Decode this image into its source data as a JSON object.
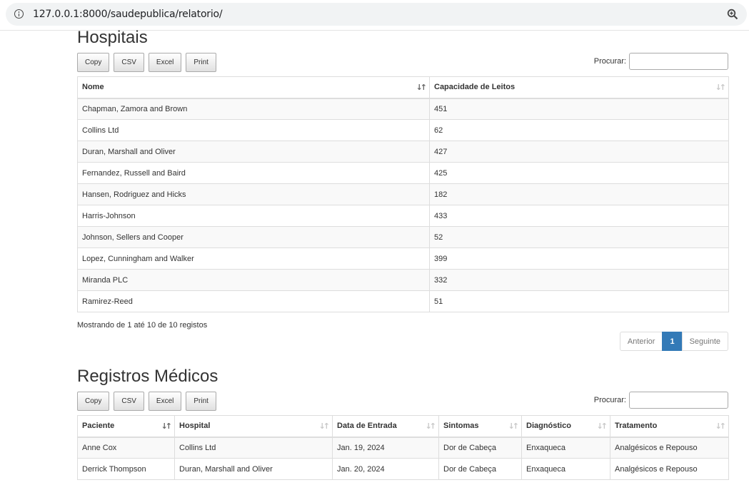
{
  "browser": {
    "url": "127.0.0.1:8000/saudepublica/relatorio/"
  },
  "buttons": {
    "copy": "Copy",
    "csv": "CSV",
    "excel": "Excel",
    "print": "Print"
  },
  "search_label": "Procurar:",
  "hospitais": {
    "title": "Hospitais",
    "columns": [
      "Nome",
      "Capacidade de Leitos"
    ],
    "rows": [
      [
        "Chapman, Zamora and Brown",
        "451"
      ],
      [
        "Collins Ltd",
        "62"
      ],
      [
        "Duran, Marshall and Oliver",
        "427"
      ],
      [
        "Fernandez, Russell and Baird",
        "425"
      ],
      [
        "Hansen, Rodriguez and Hicks",
        "182"
      ],
      [
        "Harris-Johnson",
        "433"
      ],
      [
        "Johnson, Sellers and Cooper",
        "52"
      ],
      [
        "Lopez, Cunningham and Walker",
        "399"
      ],
      [
        "Miranda PLC",
        "332"
      ],
      [
        "Ramirez-Reed",
        "51"
      ]
    ],
    "info": "Mostrando de 1 até 10 de 10 registos",
    "pagination": {
      "prev": "Anterior",
      "current": "1",
      "next": "Seguinte"
    }
  },
  "registros": {
    "title": "Registros Médicos",
    "columns": [
      "Paciente",
      "Hospital",
      "Data de Entrada",
      "Sintomas",
      "Diagnóstico",
      "Tratamento"
    ],
    "rows": [
      [
        "Anne Cox",
        "Collins Ltd",
        "Jan. 19, 2024",
        "Dor de Cabeça",
        "Enxaqueca",
        "Analgésicos e Repouso"
      ],
      [
        "Derrick Thompson",
        "Duran, Marshall and Oliver",
        "Jan. 20, 2024",
        "Dor de Cabeça",
        "Enxaqueca",
        "Analgésicos e Repouso"
      ]
    ]
  },
  "colors": {
    "accent": "#337ab7",
    "row_stripe": "#f9f9f9",
    "border": "#dddddd"
  }
}
